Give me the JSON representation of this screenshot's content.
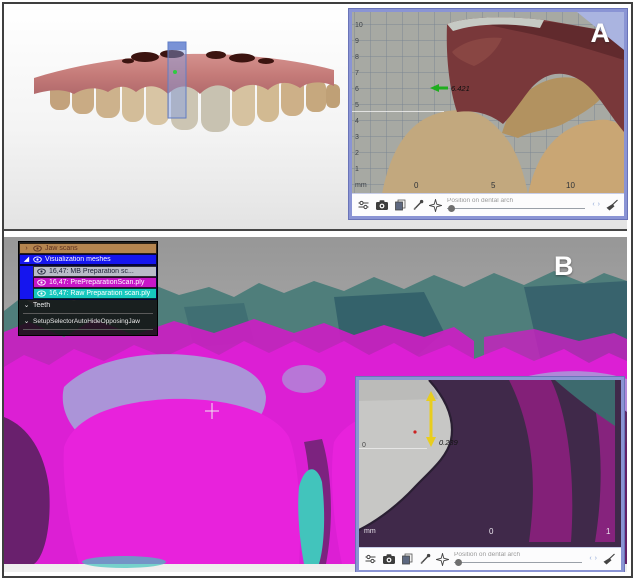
{
  "panels": {
    "a": {
      "label": "A",
      "inset": {
        "measurement_label": "6.421",
        "unit": "mm",
        "y_ticks": [
          "10",
          "9",
          "8",
          "7",
          "6",
          "5",
          "4",
          "3",
          "2",
          "1"
        ],
        "x_ticks": [
          "0",
          "5",
          "10"
        ],
        "toolbar": {
          "position_label": "Position on dental arch",
          "prev": "‹",
          "next": "›"
        }
      }
    },
    "b": {
      "label": "B",
      "sidebar": {
        "items": [
          {
            "label": "Jaw scans",
            "expander": "›",
            "color": "#b5854f",
            "icon": "eye-icon"
          },
          {
            "label": "Visualization meshes",
            "expander": "◢",
            "color": "#1515ee",
            "icon": "eye-icon"
          },
          {
            "label": "16,47: MB Preparation sc...",
            "color": "#babcc8",
            "icon": "eye-icon"
          },
          {
            "label": "16,47: PrePreparationScan.ply",
            "color": "#c716c7",
            "icon": "eye-icon"
          },
          {
            "label": "16,47: Raw Preparation scan.ply",
            "color": "#16c8be",
            "icon": "eye-icon"
          },
          {
            "label": "Teeth",
            "expander": "⌄"
          },
          {
            "label": "SetupSelectorAutoHideOpposingJaw",
            "expander": "⌄"
          }
        ]
      },
      "inset": {
        "measurement_label": "0.239",
        "unit": "mm",
        "y_ticks": [
          "0"
        ],
        "x_ticks": [
          "0",
          "1"
        ],
        "toolbar": {
          "position_label": "Position on dental arch",
          "prev": "‹",
          "next": "›"
        }
      }
    }
  },
  "toolbar_icons": [
    "sliders-icon",
    "camera-icon",
    "copy-layers-icon",
    "probe-icon",
    "star-move-icon",
    "brush-icon"
  ],
  "colors": {
    "inset_border": "#8a94d4",
    "magenta_mesh": "#dc1fd4",
    "teal_mesh": "#4f7e7b",
    "lavender_mesh": "#a89bd8",
    "measurement_green": "#1fae1f",
    "measurement_yellow": "#e8cd1e",
    "gum_pink": "#c97f7f",
    "maroon_section": "#79383a"
  }
}
